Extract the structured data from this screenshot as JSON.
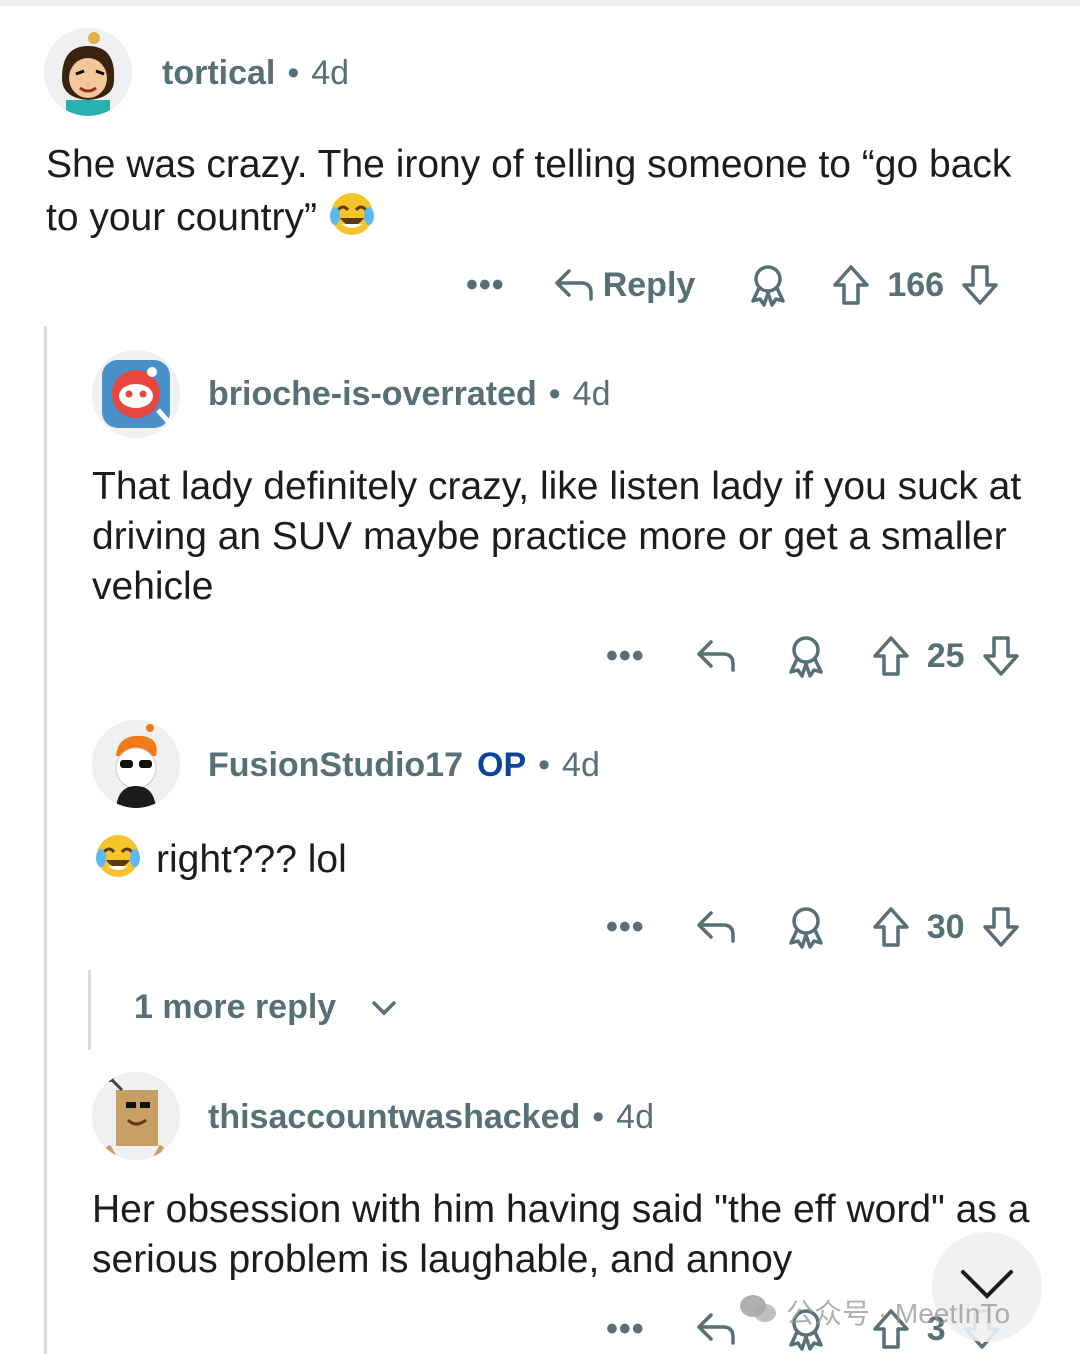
{
  "comments": [
    {
      "username": "tortical",
      "separator": "•",
      "age": "4d",
      "op_badge": "",
      "text": "She was crazy. The irony of telling someone to “go back to your country”",
      "emoji": "laughing-crying-emoji",
      "reply_label": "Reply",
      "votes": "166"
    },
    {
      "username": "brioche-is-overrated",
      "separator": "•",
      "age": "4d",
      "op_badge": "",
      "text": "That lady definitely crazy, like listen lady if you suck at driving an SUV maybe practice more or get a smaller vehicle",
      "votes": "25"
    },
    {
      "username": "FusionStudio17",
      "separator": "•",
      "age": "4d",
      "op_badge": "OP",
      "text": "right??? lol",
      "emoji": "laughing-crying-emoji",
      "votes": "30"
    },
    {
      "username": "thisaccountwashacked",
      "separator": "•",
      "age": "4d",
      "op_badge": "",
      "text": "Her obsession with him having said \"the eff word\" as a serious problem is laughable, and annoy",
      "votes": "3"
    }
  ],
  "more_replies": "1 more reply",
  "watermark": "公众号 · MeetInTo",
  "colors": {
    "meta": "#576f76",
    "op": "#0a449b",
    "thread_line": "#d9dbdd"
  }
}
